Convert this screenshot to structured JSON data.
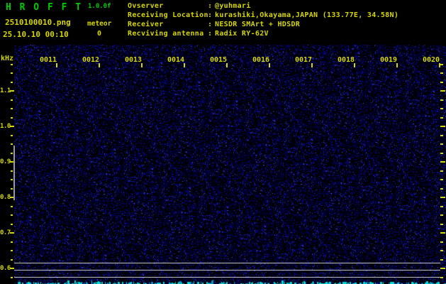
{
  "header": {
    "title": "H R O F F T",
    "version": "1.0.0f",
    "filename": "2510100010.png",
    "meteor_label": "meteor",
    "meteor_count": "0",
    "timestamp": "25.10.10 00:10",
    "info": [
      {
        "label": "Ovserver",
        "value": "@yuhmari"
      },
      {
        "label": "Receiving Location",
        "value": "kurashiki,Okayama,JAPAN (133.77E, 34.58N)"
      },
      {
        "label": "Receiver",
        "value": "NESDR SMArt + HDSDR"
      },
      {
        "label": "Recviving antenna",
        "value": "Radix RY-62V"
      }
    ]
  },
  "spectrogram": {
    "freq_axis_unit": "kHz",
    "freq_labels": [
      "1.1",
      "1.0",
      "0.9",
      "0.8",
      "0.7",
      "0.6"
    ],
    "time_labels": [
      "0011",
      "0012",
      "0013",
      "0014",
      "0015",
      "0016",
      "0017",
      "0018",
      "0019",
      "0020"
    ]
  },
  "colors": {
    "background": "#000000",
    "title_green": "#00cc00",
    "text_yellow": "#d6d600",
    "line_gray": "#bfbfbf",
    "marker_gray": "#9a9a9a",
    "strip_cyan": "#00d8d8",
    "strip_cyan_dim": "#0099bb",
    "noise_blues": [
      "#000066",
      "#0000a0",
      "#1a1ac0",
      "#3344cc",
      "#5560dd"
    ]
  }
}
